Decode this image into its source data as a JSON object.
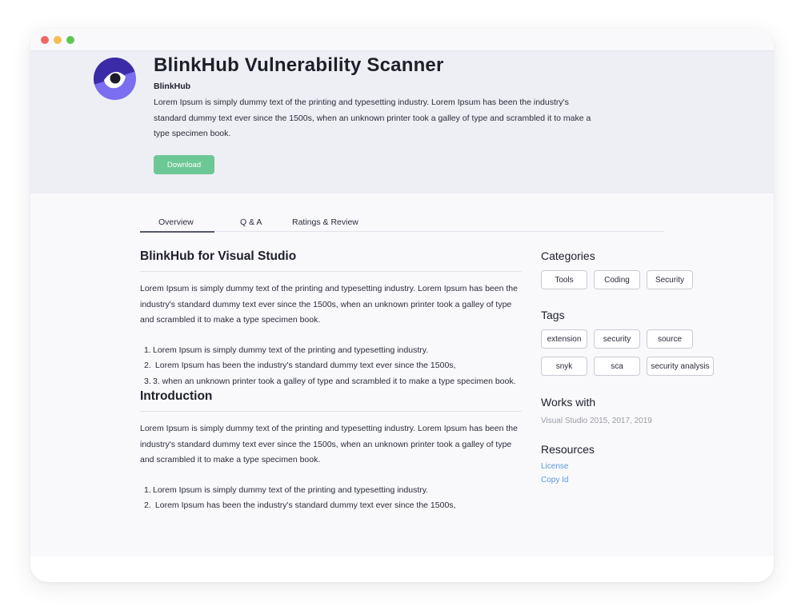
{
  "window": {
    "controls": [
      "close",
      "minimize",
      "maximize"
    ]
  },
  "hero": {
    "logo_icon": "eye-logo-icon",
    "title": "BlinkHub Vulnerability Scanner",
    "publisher": "BlinkHub",
    "description": "Lorem Ipsum is simply dummy text of the printing and typesetting industry. Lorem Ipsum has been the industry's standard dummy text ever since the 1500s, when an unknown printer took a galley of type and scrambled it to make a type specimen book.",
    "download_label": "Download",
    "download_color": "#6cc895"
  },
  "tabs": [
    {
      "label": "Overview",
      "active": true
    },
    {
      "label": "Q & A",
      "active": false
    },
    {
      "label": "Ratings & Review",
      "active": false
    }
  ],
  "main": {
    "section1": {
      "heading": "BlinkHub for Visual Studio",
      "paragraph": "Lorem Ipsum is simply dummy text of the printing and typesetting industry. Lorem Ipsum has been the industry's standard dummy text ever since the 1500s, when an unknown printer took a galley of type and scrambled it to make a type specimen book.",
      "list": [
        {
          "num": "1.",
          "text": "Lorem Ipsum is simply dummy text of the printing and typesetting industry."
        },
        {
          "num": "2.",
          "text": " Lorem Ipsum has been the industry's standard dummy text ever since the 1500s,"
        },
        {
          "num": "3.",
          "text": "3. when an unknown printer took a galley of type and scrambled it to make a type specimen book."
        }
      ]
    },
    "section2": {
      "heading": "Introduction",
      "paragraph": "Lorem Ipsum is simply dummy text of the printing and typesetting industry. Lorem Ipsum has been the industry's standard dummy text ever since the 1500s, when an unknown printer took a galley of type and scrambled it to make a type specimen book.",
      "list": [
        {
          "num": "1.",
          "text": "Lorem Ipsum is simply dummy text of the printing and typesetting industry."
        },
        {
          "num": "2.",
          "text": " Lorem Ipsum has been the industry's standard dummy text ever since the 1500s,"
        }
      ]
    }
  },
  "sidebar": {
    "categories": {
      "heading": "Categories",
      "items": [
        "Tools",
        "Coding",
        "Security"
      ]
    },
    "tags": {
      "heading": "Tags",
      "items": [
        "extension",
        "security",
        "source",
        "snyk",
        "sca",
        "security analysis"
      ]
    },
    "works_with": {
      "heading": "Works with",
      "text": "Visual Studio 2015, 2017, 2019"
    },
    "resources": {
      "heading": "Resources",
      "links": [
        "License",
        "Copy Id"
      ],
      "link_color": "#5c9ad6"
    }
  }
}
